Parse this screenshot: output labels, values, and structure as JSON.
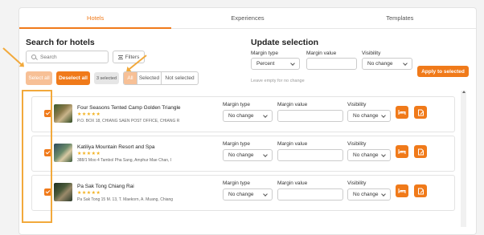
{
  "tabs": [
    {
      "label": "Hotels",
      "active": true
    },
    {
      "label": "Experiences",
      "active": false
    },
    {
      "label": "Templates",
      "active": false
    }
  ],
  "search_section": {
    "title": "Search for hotels",
    "search_placeholder": "Search",
    "filters_label": "Filters",
    "select_all_label": "Select all",
    "deselect_all_label": "Deselect all",
    "selected_count": "3 selected",
    "segments": [
      {
        "label": "All",
        "active": true
      },
      {
        "label": "Selected",
        "active": false
      },
      {
        "label": "Not selected",
        "active": false
      }
    ]
  },
  "update_section": {
    "title": "Update selection",
    "margin_type_label": "Margin type",
    "margin_type_value": "Percent",
    "margin_value_label": "Margin value",
    "margin_value": "",
    "visibility_label": "Visibility",
    "visibility_value": "No change",
    "hint": "Leave empty for no change",
    "apply_label": "Apply to selected"
  },
  "row_labels": {
    "margin_type": "Margin type",
    "margin_value": "Margin value",
    "visibility": "Visibility"
  },
  "hotels": [
    {
      "name": "Four Seasons Tented Camp Golden Triangle",
      "stars": "★★★★★",
      "address": "P.O. BOX 18, CHIANG SAEN POST OFFICE, CHIANG R",
      "margin_type": "No change",
      "visibility": "No change",
      "checked": true
    },
    {
      "name": "Katiliya Mountain Resort and Spa",
      "stars": "★★★★★",
      "address": "388/1 Moo 4 Tambol Pha Sang, Amphur Mae Chan, I",
      "margin_type": "No change",
      "visibility": "No change",
      "checked": true
    },
    {
      "name": "Pa Sak Tong Chiang Rai",
      "stars": "★★★★★",
      "address": "Pa Sak Tong 15 M. 13, T. Maekorn, A. Muang, Chiang",
      "margin_type": "No change",
      "visibility": "No change",
      "checked": true
    }
  ],
  "icons": {
    "bed": "bed-icon",
    "edit": "edit-document-icon",
    "search": "search-icon",
    "filter": "filter-icon"
  },
  "colors": {
    "accent": "#f07a1a",
    "accent_light": "#f7c096",
    "highlight": "#f2a93b",
    "stars": "#f2b01e"
  }
}
